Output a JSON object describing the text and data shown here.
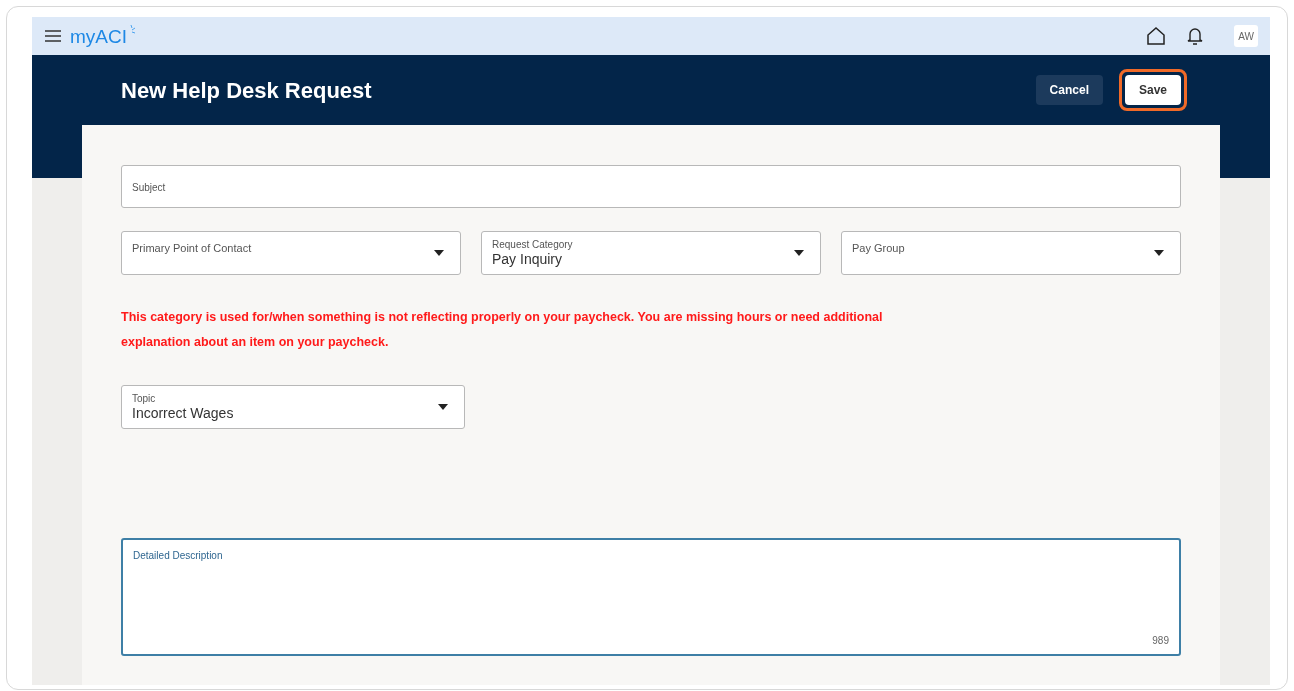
{
  "app_bar": {
    "logo": "myACI",
    "avatar": "AW"
  },
  "header": {
    "title": "New Help Desk Request",
    "buttons": [
      {
        "label": "Cancel",
        "kind": "secondary",
        "highlighted": false
      },
      {
        "label": "Save",
        "kind": "primary",
        "highlighted": true
      }
    ]
  },
  "form": {
    "subject": {
      "label": "Subject"
    },
    "selects": [
      {
        "label": "Primary Point of Contact"
      },
      {
        "label": "Request Category",
        "value": "Pay Inquiry"
      },
      {
        "label": "Pay Group"
      }
    ],
    "notice": "This category is used for/when something is not reflecting properly on your paycheck. You are missing hours or need additional explanation about an item on your paycheck.",
    "topic": {
      "label": "Topic",
      "value": "Incorrect Wages"
    },
    "description": {
      "label": "Detailed Description",
      "counter": "989",
      "focused": true
    }
  }
}
